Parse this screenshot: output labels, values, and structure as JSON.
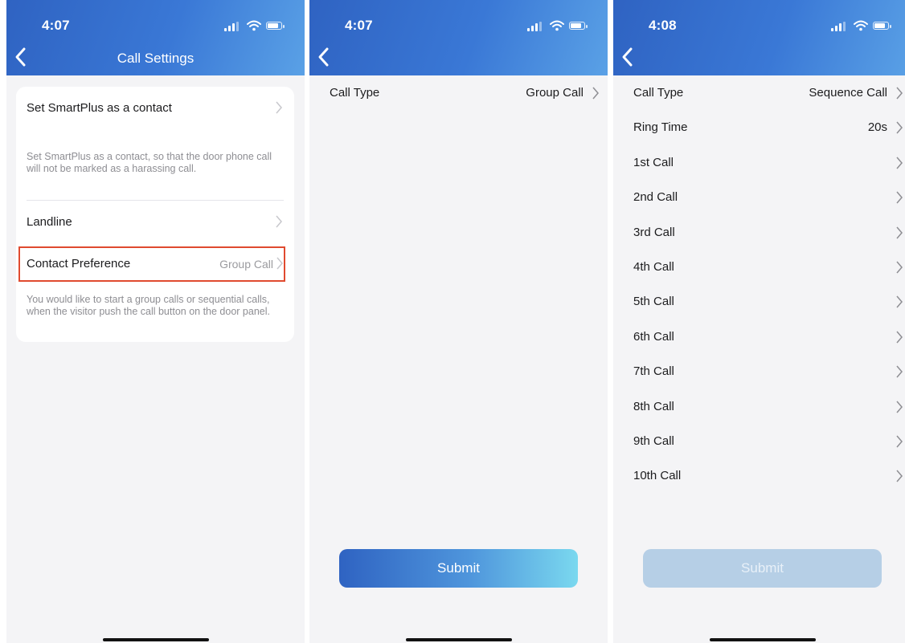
{
  "screens": [
    {
      "time": "4:07",
      "title": "Call Settings",
      "smartplus_label": "Set SmartPlus as a contact",
      "smartplus_desc": "Set SmartPlus as a contact, so that the door phone call will not be marked as a harassing call.",
      "landline_label": "Landline",
      "contact_pref_label": "Contact Preference",
      "contact_pref_value": "Group Call",
      "contact_pref_desc": "You would like to start a group calls or sequential calls, when the visitor push the call button on the door panel."
    },
    {
      "time": "4:07",
      "call_type_label": "Call Type",
      "call_type_value": "Group Call",
      "submit_label": "Submit"
    },
    {
      "time": "4:08",
      "rows": [
        {
          "label": "Call Type",
          "value": "Sequence Call"
        },
        {
          "label": "Ring Time",
          "value": "20s"
        },
        {
          "label": "1st Call",
          "value": ""
        },
        {
          "label": "2nd Call",
          "value": ""
        },
        {
          "label": "3rd Call",
          "value": ""
        },
        {
          "label": "4th Call",
          "value": ""
        },
        {
          "label": "5th Call",
          "value": ""
        },
        {
          "label": "6th Call",
          "value": ""
        },
        {
          "label": "7th Call",
          "value": ""
        },
        {
          "label": "8th Call",
          "value": ""
        },
        {
          "label": "9th Call",
          "value": ""
        },
        {
          "label": "10th Call",
          "value": ""
        }
      ],
      "submit_label": "Submit"
    }
  ],
  "colors": {
    "header_gradient_start": "#2f63c2",
    "header_gradient_end": "#5aa1e6",
    "highlight_border": "#e04a2f",
    "submit_disabled": "#b6cfe6"
  },
  "icons": {
    "back": "chevron-left-icon",
    "row": "chevron-right-icon",
    "signal": "signal-icon",
    "wifi": "wifi-icon",
    "battery": "battery-icon"
  }
}
